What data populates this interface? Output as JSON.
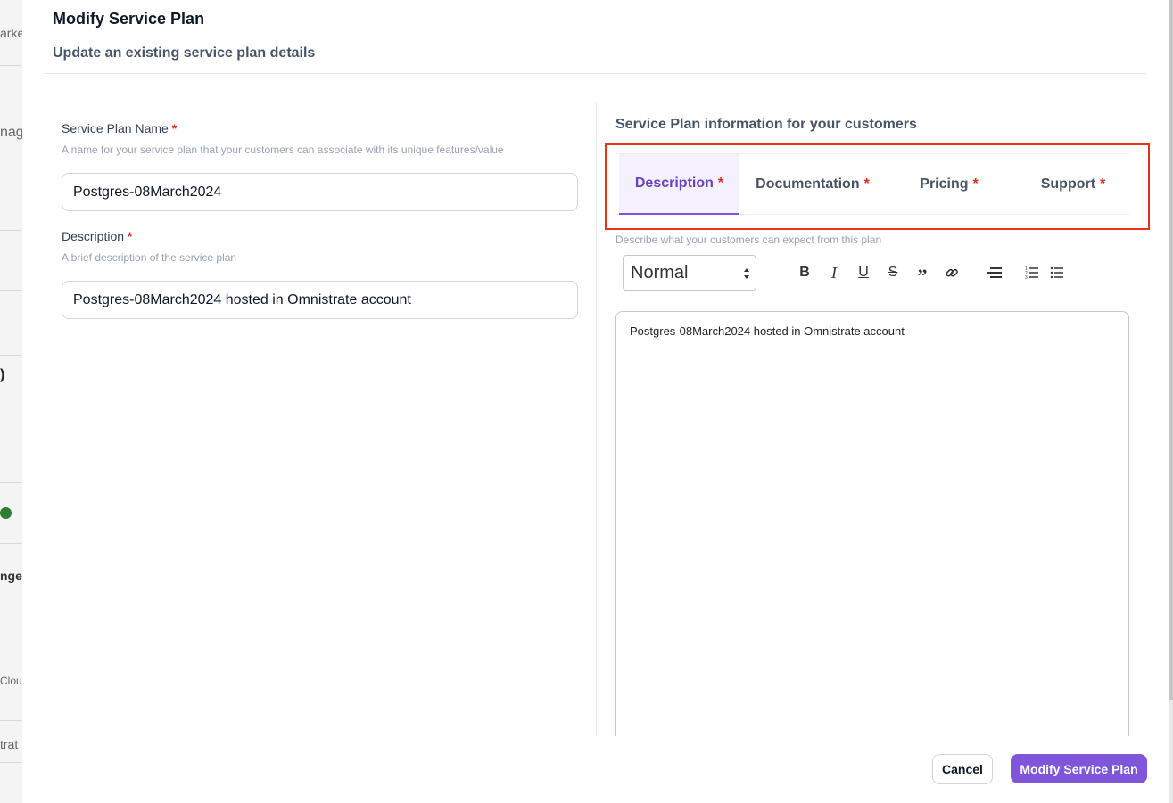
{
  "background": {
    "fragments": [
      "arke",
      "nag",
      ")",
      "nge",
      "Clou",
      "trat"
    ]
  },
  "modal": {
    "title": "Modify Service Plan",
    "subtitle": "Update an existing service plan details"
  },
  "form": {
    "required_mark": "*",
    "name": {
      "label": "Service Plan Name",
      "help": "A name for your service plan that your customers can associate with its unique features/value",
      "value": "Postgres-08March2024"
    },
    "description": {
      "label": "Description",
      "help": "A brief description of the service plan",
      "value": "Postgres-08March2024 hosted in Omnistrate account"
    }
  },
  "info_panel": {
    "title": "Service Plan information for your customers",
    "tabs": [
      {
        "label": "Description",
        "active": true
      },
      {
        "label": "Documentation",
        "active": false
      },
      {
        "label": "Pricing",
        "active": false
      },
      {
        "label": "Support",
        "active": false
      }
    ],
    "editor_help": "Describe what your customers can expect from this plan",
    "toolbar": {
      "format_value": "Normal",
      "icons": [
        "bold-icon",
        "italic-icon",
        "underline-icon",
        "strikethrough-icon",
        "quote-icon",
        "link-icon",
        "align-icon",
        "ordered-list-icon",
        "bullet-list-icon"
      ]
    },
    "editor_content": "Postgres-08March2024 hosted in Omnistrate account"
  },
  "footer": {
    "cancel_label": "Cancel",
    "submit_label": "Modify Service Plan"
  },
  "colors": {
    "accent": "#7f56d9",
    "highlight_border": "#e5341c",
    "required": "#d92d20"
  }
}
